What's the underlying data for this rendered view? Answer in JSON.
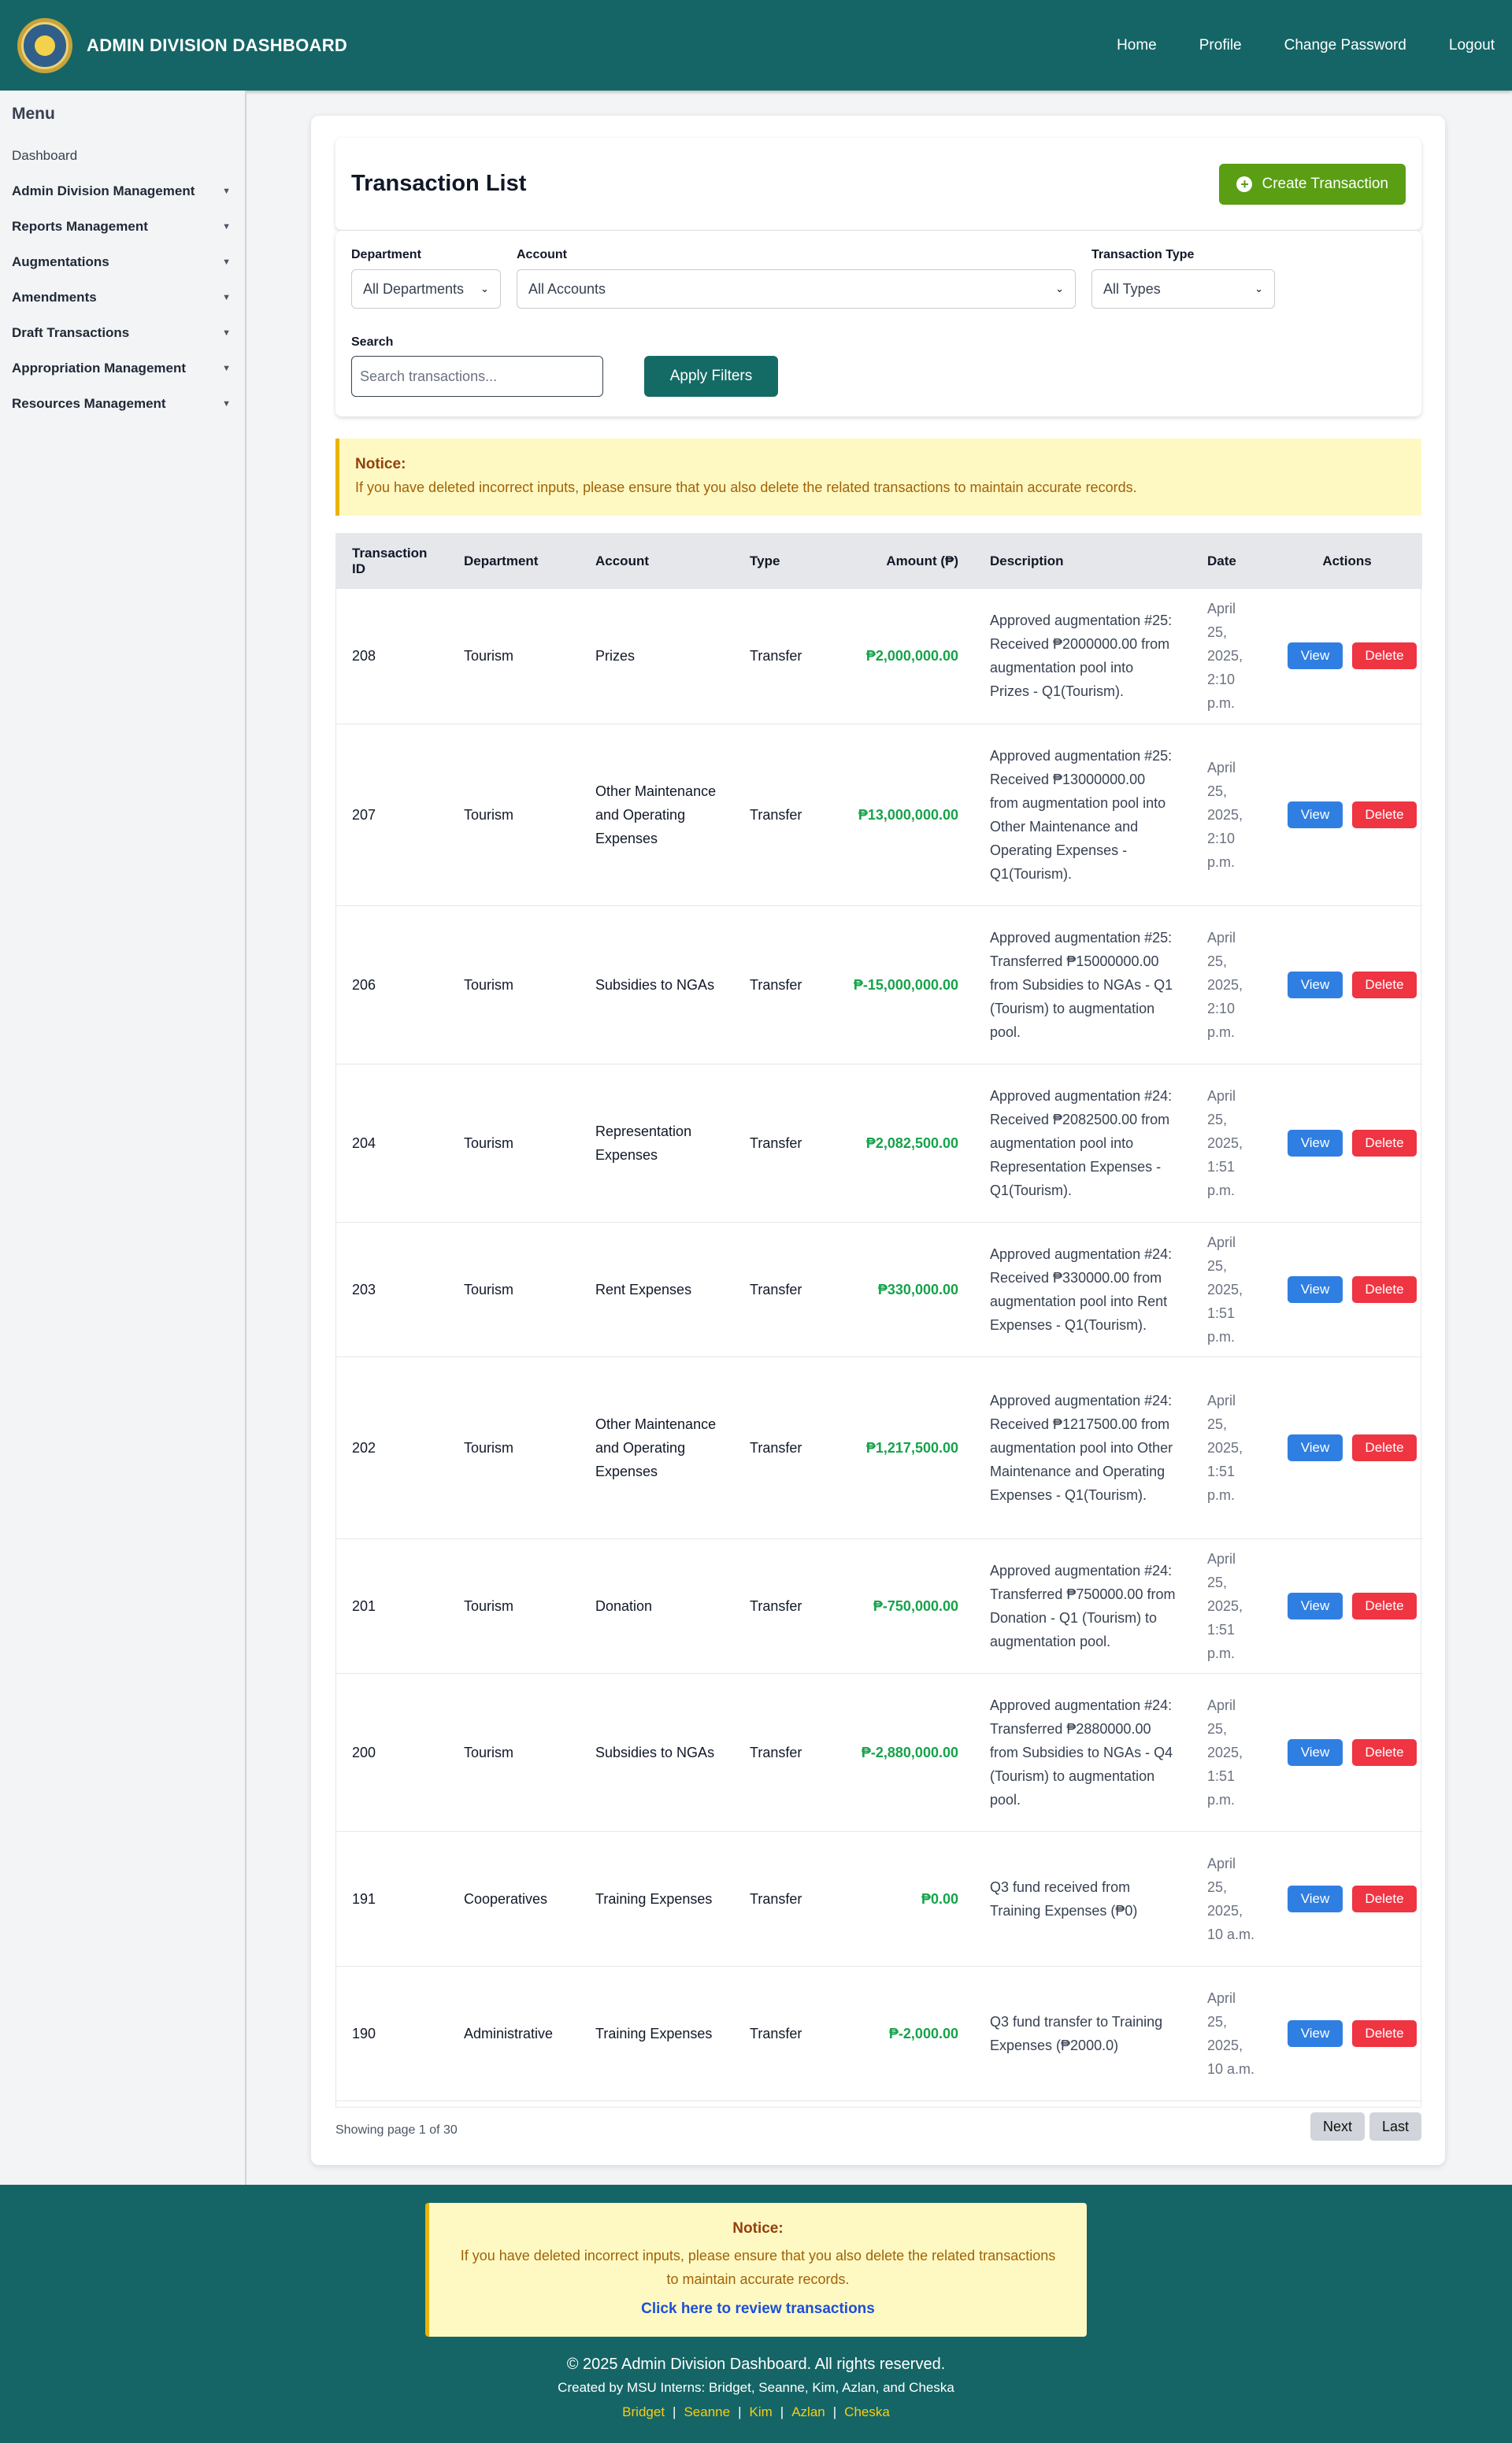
{
  "header": {
    "title": "ADMIN DIVISION DASHBOARD",
    "nav": [
      "Home",
      "Profile",
      "Change Password",
      "Logout"
    ]
  },
  "sidebar": {
    "title": "Menu",
    "items": [
      {
        "label": "Dashboard",
        "dropdown": false
      },
      {
        "label": "Admin Division Management",
        "dropdown": true
      },
      {
        "label": "Reports Management",
        "dropdown": true
      },
      {
        "label": "Augmentations",
        "dropdown": true
      },
      {
        "label": "Amendments",
        "dropdown": true
      },
      {
        "label": "Draft Transactions",
        "dropdown": true
      },
      {
        "label": "Appropriation Management",
        "dropdown": true
      },
      {
        "label": "Resources Management",
        "dropdown": true
      }
    ]
  },
  "page": {
    "title": "Transaction List",
    "create_label": "Create Transaction"
  },
  "filters": {
    "department_label": "Department",
    "department_value": "All Departments",
    "account_label": "Account",
    "account_value": "All Accounts",
    "type_label": "Transaction Type",
    "type_value": "All Types",
    "search_label": "Search",
    "search_placeholder": "Search transactions...",
    "apply_label": "Apply Filters"
  },
  "notice": {
    "title": "Notice:",
    "text": "If you have deleted incorrect inputs, please ensure that you also delete the related transactions to maintain accurate records."
  },
  "table": {
    "headers": [
      "Transaction ID",
      "Department",
      "Account",
      "Type",
      "Amount (₱)",
      "Description",
      "Date",
      "Actions"
    ],
    "view_label": "View",
    "delete_label": "Delete",
    "rows": [
      {
        "id": "208",
        "department": "Tourism",
        "account": "Prizes",
        "type": "Transfer",
        "amount": "₱2,000,000.00",
        "description": "Approved augmentation #25: Received ₱2000000.00 from augmentation pool into Prizes - Q1(Tourism).",
        "date": "April 25, 2025, 2:10 p.m."
      },
      {
        "id": "207",
        "department": "Tourism",
        "account": "Other Maintenance and Operating Expenses",
        "type": "Transfer",
        "amount": "₱13,000,000.00",
        "description": "Approved augmentation #25: Received ₱13000000.00 from augmentation pool into Other Maintenance and Operating Expenses - Q1(Tourism).",
        "date": "April 25, 2025, 2:10 p.m."
      },
      {
        "id": "206",
        "department": "Tourism",
        "account": "Subsidies to NGAs",
        "type": "Transfer",
        "amount": "₱-15,000,000.00",
        "description": "Approved augmentation #25: Transferred ₱15000000.00 from Subsidies to NGAs - Q1 (Tourism) to augmentation pool.",
        "date": "April 25, 2025, 2:10 p.m."
      },
      {
        "id": "204",
        "department": "Tourism",
        "account": "Representation Expenses",
        "type": "Transfer",
        "amount": "₱2,082,500.00",
        "description": "Approved augmentation #24: Received ₱2082500.00 from augmentation pool into Representation Expenses - Q1(Tourism).",
        "date": "April 25, 2025, 1:51 p.m."
      },
      {
        "id": "203",
        "department": "Tourism",
        "account": "Rent Expenses",
        "type": "Transfer",
        "amount": "₱330,000.00",
        "description": "Approved augmentation #24: Received ₱330000.00 from augmentation pool into Rent Expenses - Q1(Tourism).",
        "date": "April 25, 2025, 1:51 p.m."
      },
      {
        "id": "202",
        "department": "Tourism",
        "account": "Other Maintenance and Operating Expenses",
        "type": "Transfer",
        "amount": "₱1,217,500.00",
        "description": "Approved augmentation #24: Received ₱1217500.00 from augmentation pool into Other Maintenance and Operating Expenses - Q1(Tourism).",
        "date": "April 25, 2025, 1:51 p.m."
      },
      {
        "id": "201",
        "department": "Tourism",
        "account": "Donation",
        "type": "Transfer",
        "amount": "₱-750,000.00",
        "description": "Approved augmentation #24: Transferred ₱750000.00 from Donation - Q1 (Tourism) to augmentation pool.",
        "date": "April 25, 2025, 1:51 p.m."
      },
      {
        "id": "200",
        "department": "Tourism",
        "account": "Subsidies to NGAs",
        "type": "Transfer",
        "amount": "₱-2,880,000.00",
        "description": "Approved augmentation #24: Transferred ₱2880000.00 from Subsidies to NGAs - Q4 (Tourism) to augmentation pool.",
        "date": "April 25, 2025, 1:51 p.m."
      },
      {
        "id": "191",
        "department": "Cooperatives",
        "account": "Training Expenses",
        "type": "Transfer",
        "amount": "₱0.00",
        "description": "Q3 fund received from Training Expenses (₱0)",
        "date": "April 25, 2025, 10 a.m."
      },
      {
        "id": "190",
        "department": "Administrative",
        "account": "Training Expenses",
        "type": "Transfer",
        "amount": "₱-2,000.00",
        "description": "Q3 fund transfer to Training Expenses (₱2000.0)",
        "date": "April 25, 2025, 10 a.m."
      }
    ]
  },
  "pagination": {
    "info": "Showing page 1 of 30",
    "next_label": "Next",
    "last_label": "Last"
  },
  "footer": {
    "notice_title": "Notice:",
    "notice_text": "If you have deleted incorrect inputs, please ensure that you also delete the related transactions to maintain accurate records.",
    "notice_link": "Click here to review transactions",
    "copyright": "© 2025 Admin Division Dashboard. All rights reserved.",
    "credits": "Created by MSU Interns: Bridget, Seanne, Kim, Azlan, and Cheska",
    "names": [
      "Bridget",
      "Seanne",
      "Kim",
      "Azlan",
      "Cheska"
    ]
  },
  "colors": {
    "header_bg": "#156566",
    "accent_green": "#5a9e14",
    "amount_green": "#16a34a",
    "view_blue": "#2f7fe3",
    "delete_red": "#ef3442",
    "notice_bg": "#fef9c3"
  }
}
